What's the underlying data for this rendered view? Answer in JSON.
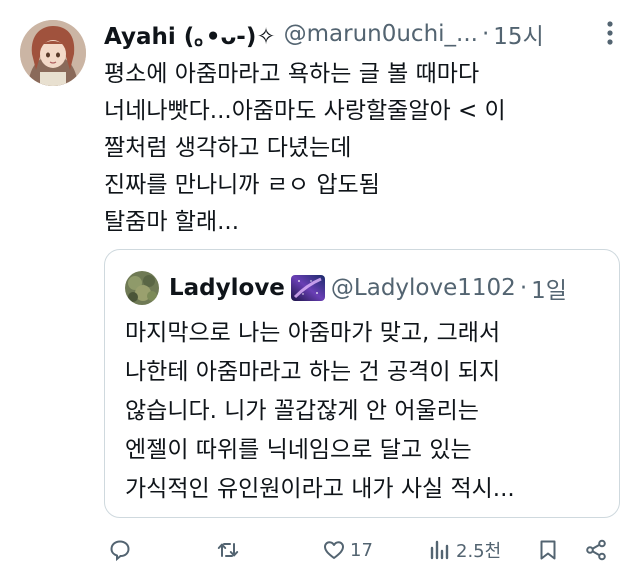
{
  "tweet": {
    "display_name": "Ayahi (｡•ᴗ-)✧",
    "handle": "@marun0uchi_...",
    "dot": "·",
    "time": "15시",
    "avatar_icon": "anime-avatar",
    "more_icon": "more-vertical-icon",
    "lines": [
      "평소에 아줌마라고 욕하는 글 볼 때마다",
      "너네나빳다...아줌마도 사랑할줄알아 < 이",
      "짤처럼 생각하고 다녔는데",
      "진짜를 만나니까 ㄹㅇ 압도됨",
      "탈줌마 할래..."
    ]
  },
  "quote": {
    "display_name": "Ladylove",
    "emoji_icon": "galaxy-emoji",
    "handle": "@Ladylove1102",
    "dot": "·",
    "time": "1일",
    "lines": [
      "마지막으로 나는 아줌마가 맞고, 그래서",
      "나한테 아줌마라고 하는 건 공격이 되지",
      "않습니다. 니가 꼴갑잖게 안 어울리는",
      "엔젤이 따위를 닉네임으로 달고 있는",
      "가식적인 유인원이라고 내가 사실 적시..."
    ]
  },
  "actions": {
    "reply_icon": "reply-icon",
    "retweet_icon": "retweet-icon",
    "like_icon": "heart-icon",
    "like_count": "17",
    "views_icon": "views-chart-icon",
    "views_count": "2.5천",
    "bookmark_icon": "bookmark-icon",
    "share_icon": "share-icon"
  },
  "colors": {
    "text": "#0f1419",
    "secondary": "#536471",
    "border": "#cfd9de",
    "background": "#ffffff"
  }
}
